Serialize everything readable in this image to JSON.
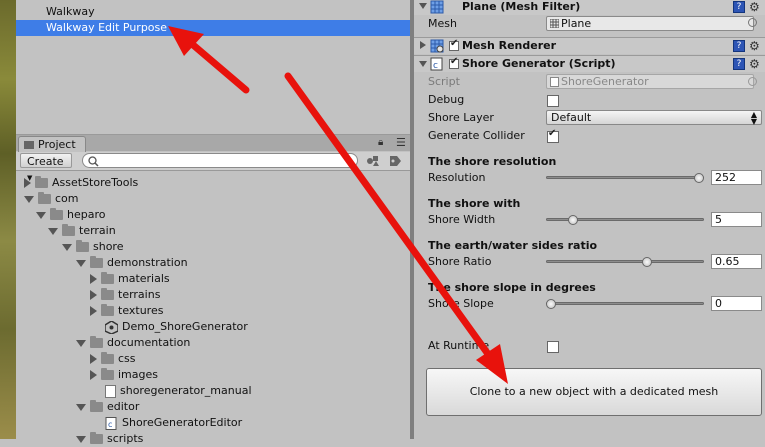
{
  "colors": {
    "selection": "#3e7de7",
    "panel": "#c2c2c2",
    "arrow": "#e8120c"
  },
  "hierarchy": {
    "items": [
      {
        "label": "Walkway",
        "selected": false
      },
      {
        "label": "Walkway Edit Purpose",
        "selected": true
      }
    ]
  },
  "project": {
    "tab_label": "Project",
    "create_label": "Create",
    "tree": [
      {
        "label": "AssetStoreTools",
        "icon": "folder-icon",
        "expanded": false
      },
      {
        "label": "com",
        "icon": "folder-icon",
        "expanded": true
      },
      {
        "label": "heparo",
        "icon": "folder-icon",
        "expanded": true
      },
      {
        "label": "terrain",
        "icon": "folder-icon",
        "expanded": true
      },
      {
        "label": "shore",
        "icon": "folder-icon",
        "expanded": true
      },
      {
        "label": "demonstration",
        "icon": "folder-icon",
        "expanded": true
      },
      {
        "label": "materials",
        "icon": "folder-icon",
        "expanded": false
      },
      {
        "label": "terrains",
        "icon": "folder-icon",
        "expanded": false
      },
      {
        "label": "textures",
        "icon": "folder-icon",
        "expanded": false
      },
      {
        "label": "Demo_ShoreGenerator",
        "icon": "unity-scene-icon"
      },
      {
        "label": "documentation",
        "icon": "folder-icon",
        "expanded": true
      },
      {
        "label": "css",
        "icon": "folder-icon",
        "expanded": false
      },
      {
        "label": "images",
        "icon": "folder-icon",
        "expanded": false
      },
      {
        "label": "shoregenerator_manual",
        "icon": "document-icon"
      },
      {
        "label": "editor",
        "icon": "folder-icon",
        "expanded": true
      },
      {
        "label": "ShoreGeneratorEditor",
        "icon": "script-icon"
      },
      {
        "label": "scripts",
        "icon": "folder-icon",
        "expanded": true
      }
    ]
  },
  "inspector": {
    "mesh_filter": {
      "title": "Plane (Mesh Filter)",
      "mesh_label": "Mesh",
      "mesh_value": "Plane"
    },
    "mesh_renderer": {
      "title": "Mesh Renderer",
      "enabled": true
    },
    "shore_generator": {
      "title": "Shore Generator (Script)",
      "enabled": true,
      "script_label": "Script",
      "script_value": "ShoreGenerator",
      "debug_label": "Debug",
      "debug": false,
      "layer_label": "Shore Layer",
      "layer_value": "Default",
      "collider_label": "Generate Collider",
      "collider": true,
      "sections": [
        {
          "heading": "The shore resolution",
          "label": "Resolution",
          "value": "252",
          "fraction": 1.0
        },
        {
          "heading": "The shore with",
          "label": "Shore Width",
          "value": "5",
          "fraction": 0.15
        },
        {
          "heading": "The earth/water sides ratio",
          "label": "Shore Ratio",
          "value": "0.65",
          "fraction": 0.65
        },
        {
          "heading": "The shore slope in degrees",
          "label": "Shore Slope",
          "value": "0",
          "fraction": 0.0
        }
      ],
      "runtime_label": "At Runtime",
      "runtime": false,
      "clone_button_label": "Clone to a new object with a dedicated mesh"
    }
  }
}
